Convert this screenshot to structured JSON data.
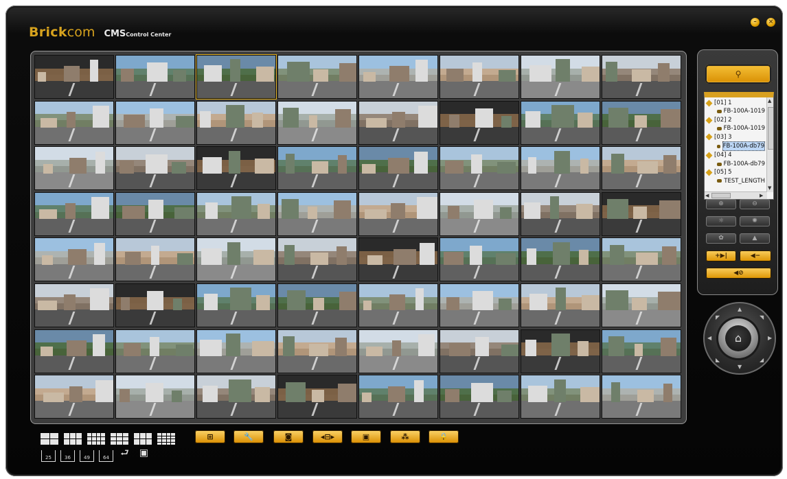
{
  "header": {
    "brand_bold": "Brick",
    "brand_light": "com",
    "product": "CMS",
    "subtitle": "Control Center",
    "minimize_glyph": "–",
    "close_glyph": "×"
  },
  "grid": {
    "rows": 8,
    "cols": 8,
    "selected_tile": 2,
    "palettes": [
      {
        "sky": "#2a2a2a",
        "mid": "#8a6a4a",
        "road": "#3a3a3a"
      },
      {
        "sky": "#a9c4dc",
        "mid": "#7a8a6a",
        "road": "#707070"
      },
      {
        "sky": "#d2dce6",
        "mid": "#a0a8a0",
        "road": "#8a8a8a"
      },
      {
        "sky": "#7ea8cc",
        "mid": "#5a7a5a",
        "road": "#606060"
      },
      {
        "sky": "#9cc0e0",
        "mid": "#b0b0a8",
        "road": "#7a7a7a"
      },
      {
        "sky": "#c8d0d8",
        "mid": "#8c7a6a",
        "road": "#555555"
      },
      {
        "sky": "#6a8aa8",
        "mid": "#4a6a3a",
        "road": "#5a5a5a"
      },
      {
        "sky": "#b8c8d8",
        "mid": "#c4a484",
        "road": "#6a6a6a"
      }
    ]
  },
  "sidebar": {
    "search_icon": "search-icon",
    "search_glyph": "⚲",
    "tree": [
      {
        "kind": "group",
        "label": "[01] 1"
      },
      {
        "kind": "device",
        "label": "FB-100A-1019"
      },
      {
        "kind": "group",
        "label": "[02] 2"
      },
      {
        "kind": "device",
        "label": "FB-100A-1019"
      },
      {
        "kind": "group",
        "label": "[03] 3"
      },
      {
        "kind": "device",
        "label": "FB-100A-db79",
        "selected": true
      },
      {
        "kind": "group",
        "label": "[04] 4"
      },
      {
        "kind": "device",
        "label": "FB-100A-db79"
      },
      {
        "kind": "group",
        "label": "[05] 5"
      },
      {
        "kind": "device",
        "label": "TEST_LENGTH"
      }
    ],
    "scroll_up": "▲",
    "scroll_down": "▼",
    "scroll_left": "◀",
    "scroll_right": "▶",
    "buttons": {
      "zoom_in": "⊕",
      "zoom_out": "⊖",
      "bright_down": "☼",
      "bright_up": "✺",
      "focus_near": "✿",
      "focus_far": "▲",
      "audio_talk": "+▶|",
      "audio_down": "◀−",
      "audio_mute": "◀⊘"
    }
  },
  "ptz": {
    "home_glyph": "⌂",
    "arrows": [
      "▲",
      "▼",
      "◀",
      "▶",
      "◤",
      "◥",
      "◣",
      "◢"
    ]
  },
  "toolbar": {
    "layouts": [
      {
        "cols": 2,
        "rows": 2
      },
      {
        "cols": 3,
        "rows": 2
      },
      {
        "cols": 4,
        "rows": 3
      },
      {
        "cols": 3,
        "rows": 3
      },
      {
        "cols": 3,
        "rows": 2
      },
      {
        "cols": 4,
        "rows": 4
      }
    ],
    "counts": [
      "25",
      "36",
      "49",
      "64"
    ],
    "extra_icons": [
      "⮐",
      "▣"
    ],
    "buttons": [
      "⊞",
      "🔧",
      "◙",
      "◂⊟▸",
      "▣",
      "⁂",
      "🔒"
    ]
  }
}
